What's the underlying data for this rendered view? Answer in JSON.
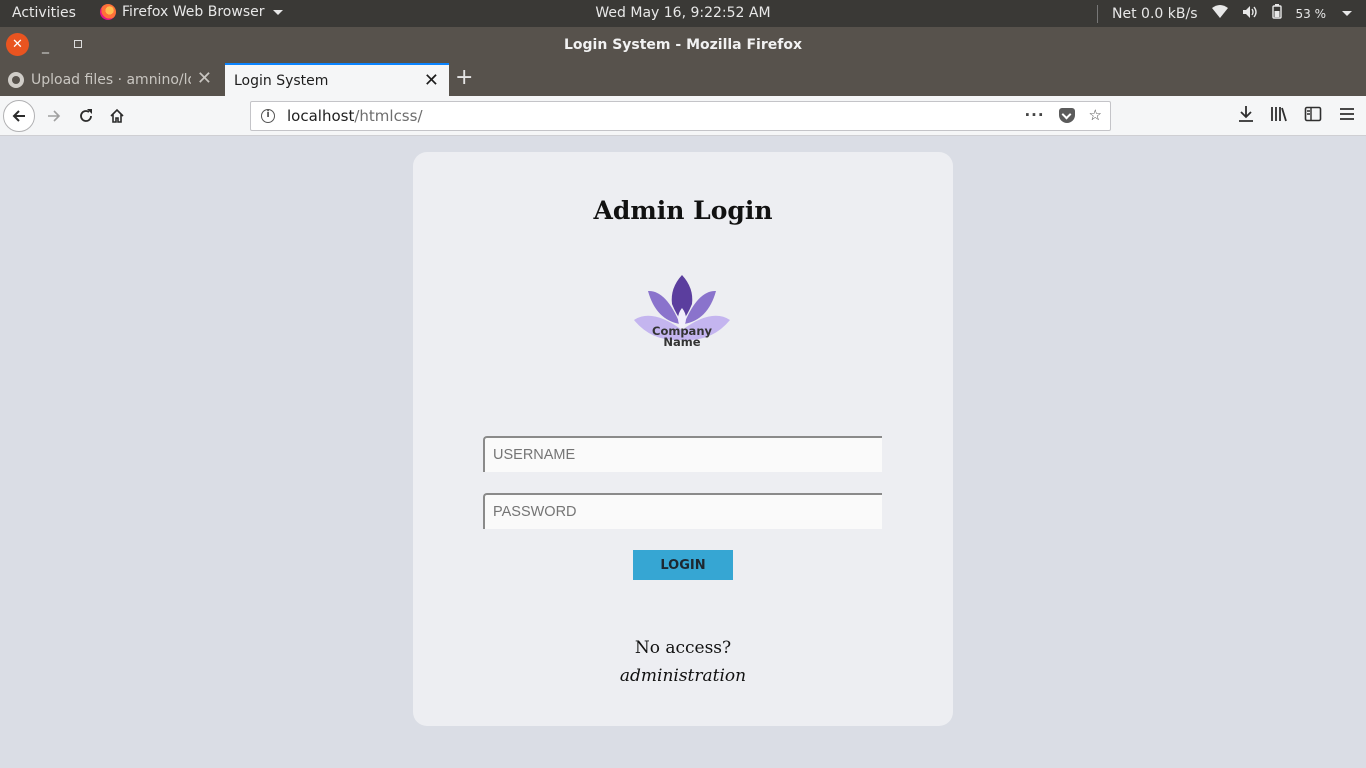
{
  "system": {
    "activities": "Activities",
    "app_menu": "Firefox Web Browser",
    "clock": "Wed May 16,  9:22:52 AM",
    "net": "Net 0.0 kB/s",
    "battery": "53 %"
  },
  "window": {
    "title": "Login System - Mozilla Firefox"
  },
  "tabs": [
    {
      "label": "Upload files · amnino/log"
    },
    {
      "label": "Login System"
    }
  ],
  "urlbar": {
    "host": "localhost",
    "path": "/htmlcss/"
  },
  "page": {
    "heading": "Admin Login",
    "logo_line1": "Company",
    "logo_line2": "Name",
    "username_placeholder": "USERNAME",
    "password_placeholder": "PASSWORD",
    "login_label": "LOGIN",
    "no_access": "No access?",
    "admin_link": "administration"
  },
  "colors": {
    "page_bg": "#dadde5",
    "card_bg": "#edeef2",
    "login_button": "#36a6d3",
    "logo_dark": "#5b3e9e",
    "logo_mid": "#8a73cc",
    "logo_light": "#c4b5ef"
  }
}
